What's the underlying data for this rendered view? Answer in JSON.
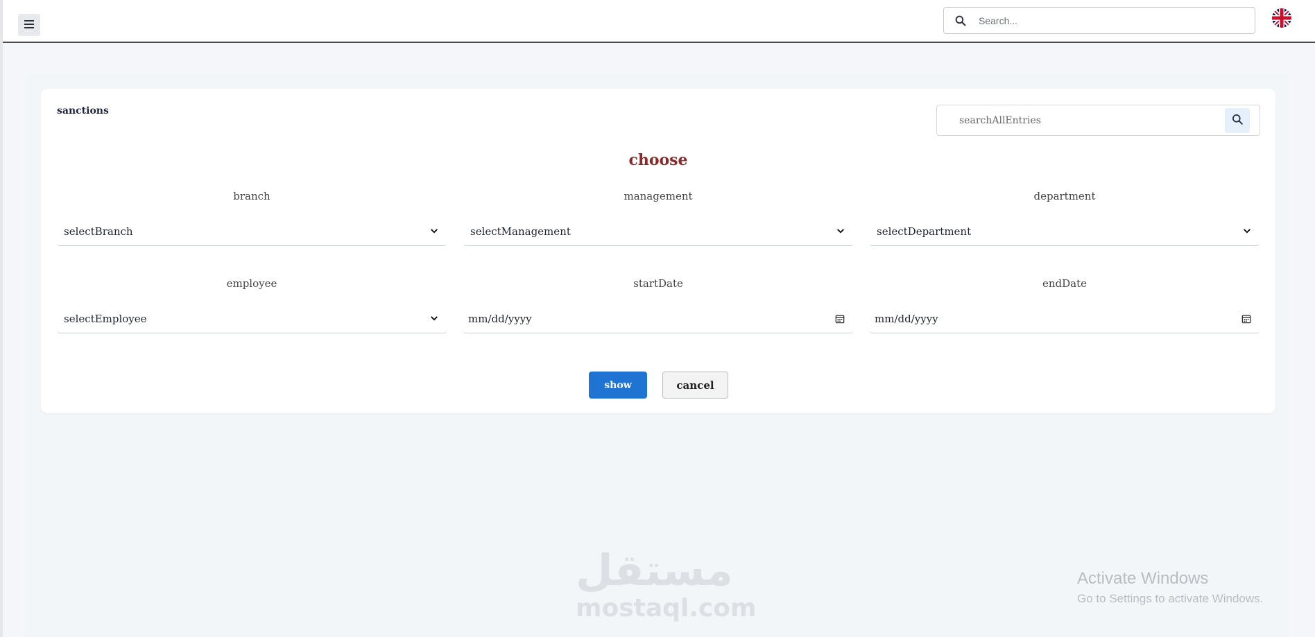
{
  "header": {
    "search_placeholder": "Search...",
    "menu_icon": "hamburger-icon",
    "language_icon": "uk-flag-icon"
  },
  "card": {
    "title": "sanctions",
    "search_placeholder": "searchAllEntries",
    "heading": "choose",
    "heading_color": "#8a2a2a"
  },
  "filters": {
    "branch": {
      "label": "branch",
      "value": "selectBranch"
    },
    "management": {
      "label": "management",
      "value": "selectManagement"
    },
    "department": {
      "label": "department",
      "value": "selectDepartment"
    },
    "employee": {
      "label": "employee",
      "value": "selectEmployee"
    },
    "start_date": {
      "label": "startDate",
      "value": "mm/dd/yyyy"
    },
    "end_date": {
      "label": "endDate",
      "value": "mm/dd/yyyy"
    }
  },
  "actions": {
    "show_label": "show",
    "cancel_label": "cancel",
    "primary_color": "#1f74d3"
  },
  "watermark": {
    "arabic": "مستقل",
    "domain": "mostaql.com"
  },
  "windows_notice": {
    "title": "Activate Windows",
    "subtitle": "Go to Settings to activate Windows."
  }
}
